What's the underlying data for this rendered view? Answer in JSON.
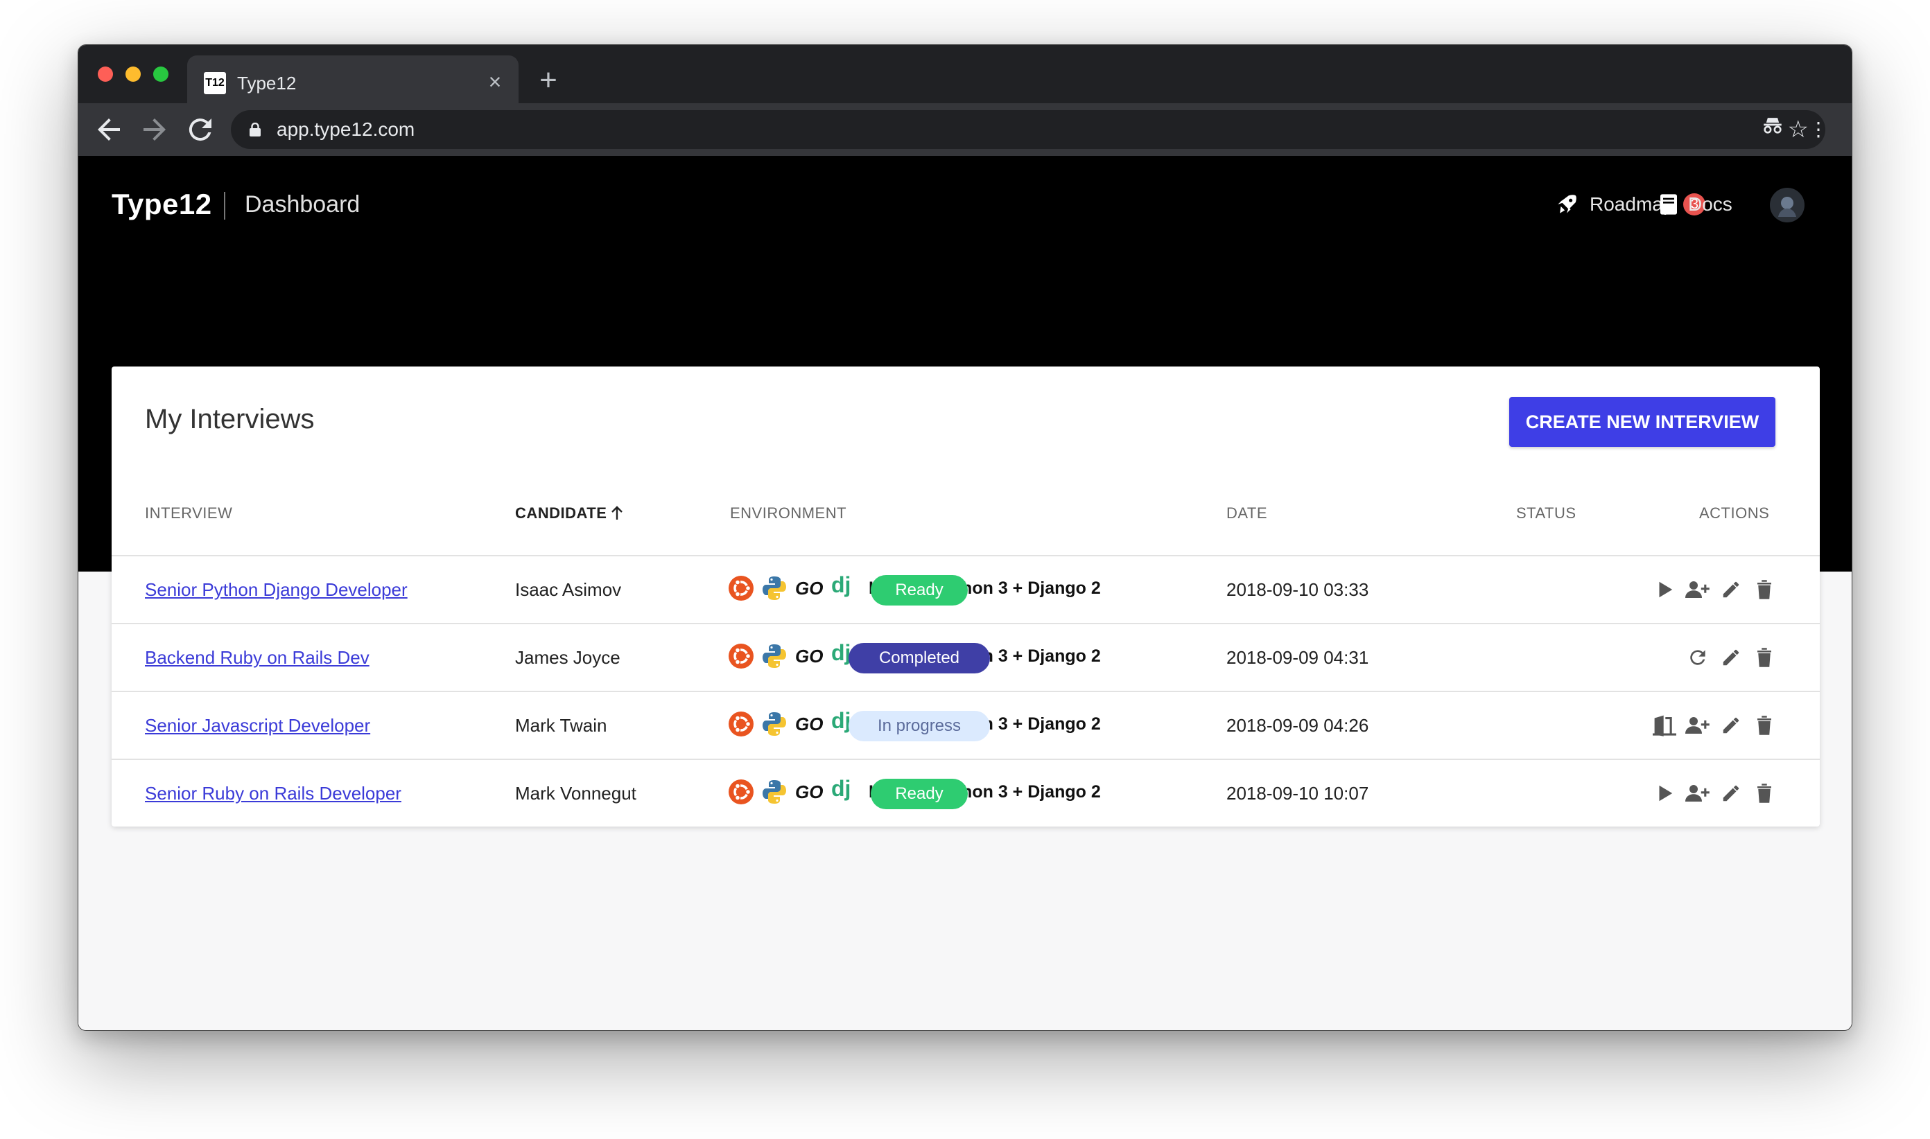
{
  "browser": {
    "tab_title": "Type12",
    "tab_favicon_text": "T12",
    "url": "app.type12.com"
  },
  "header": {
    "brand": "Type12",
    "section": "Dashboard",
    "roadmap_label": "Roadmap",
    "roadmap_count": "3",
    "docs_label": "Docs"
  },
  "card": {
    "title": "My Interviews",
    "create_button": "CREATE NEW INTERVIEW"
  },
  "table": {
    "columns": {
      "interview": "INTERVIEW",
      "candidate": "CANDIDATE",
      "environment": "ENVIRONMENT",
      "date": "DATE",
      "status": "STATUS",
      "actions": "ACTIONS"
    },
    "sorted_by": "candidate",
    "sort_direction": "ascending",
    "rows": [
      {
        "interview": "Senior Python Django Developer",
        "candidate": "Isaac Asimov",
        "environment": "Linux + Python 3 + Django 2",
        "date": "2018-09-10 03:33",
        "status": "Ready",
        "actions": [
          "play-icon",
          "add-user-icon",
          "edit-icon",
          "delete-icon"
        ]
      },
      {
        "interview": "Backend Ruby on Rails Dev",
        "candidate": "James Joyce",
        "environment": "Linux + Python 3 + Django 2",
        "date": "2018-09-09 04:31",
        "status": "Completed",
        "actions": [
          "redo-icon",
          "edit-icon",
          "delete-icon"
        ]
      },
      {
        "interview": "Senior Javascript Developer",
        "candidate": "Mark Twain",
        "environment": "Linux + Python 3 + Django 2",
        "date": "2018-09-09 04:26",
        "status": "In progress",
        "actions": [
          "join-room-icon",
          "add-user-icon",
          "edit-icon",
          "delete-icon"
        ]
      },
      {
        "interview": "Senior Ruby on Rails Developer",
        "candidate": "Mark Vonnegut",
        "environment": "Linux + Python 3 + Django 2",
        "date": "2018-09-10 10:07",
        "status": "Ready",
        "actions": [
          "play-icon",
          "add-user-icon",
          "edit-icon",
          "delete-icon"
        ]
      }
    ]
  },
  "colors": {
    "accent": "#3e3ee6",
    "ready": "#2ecc71",
    "completed": "#3f3fa6",
    "in_progress_bg": "#dbeafe",
    "badge": "#e8534f",
    "hero": "#000000"
  }
}
